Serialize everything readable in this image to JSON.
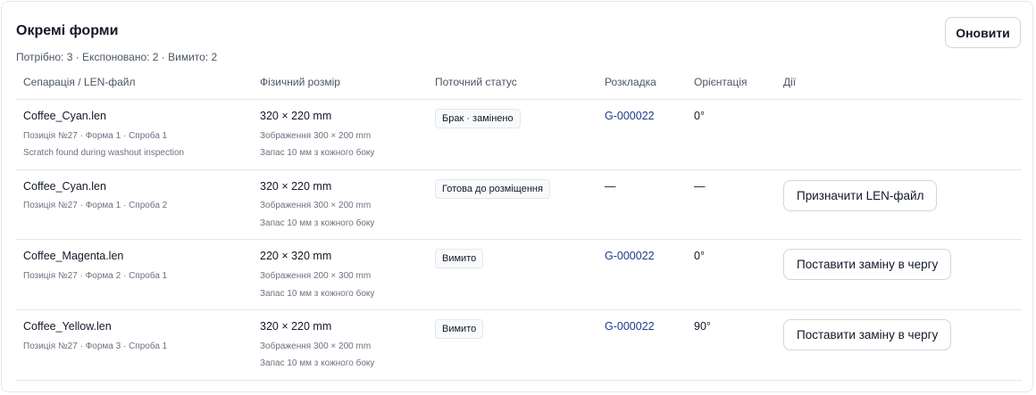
{
  "panel": {
    "title": "Окремі форми",
    "summary": "Потрібно: 3 · Експоновано: 2 · Вимито: 2",
    "refresh_label": "Оновити"
  },
  "table": {
    "headers": [
      "Сепарація / LEN-файл",
      "Фізичний розмір",
      "Поточний статус",
      "Розкладка",
      "Орієнтація",
      "Дії"
    ],
    "rows": [
      {
        "file": "Coffee_Cyan.len",
        "meta": "Позиція №27 · Форма 1 · Спроба 1",
        "note": "Scratch found during washout inspection",
        "size": "320 × 220 mm",
        "image_size": "Зображення 300 × 200 mm",
        "margin": "Запас 10 мм з кожного боку",
        "status": "Брак · замінено",
        "layout": "G-000022",
        "orientation": "0°",
        "action": ""
      },
      {
        "file": "Coffee_Cyan.len",
        "meta": "Позиція №27 · Форма 1 · Спроба 2",
        "note": "",
        "size": "320 × 220 mm",
        "image_size": "Зображення 300 × 200 mm",
        "margin": "Запас 10 мм з кожного боку",
        "status": "Готова до розміщення",
        "layout": "—",
        "orientation": "—",
        "action": "Призначити LEN-файл"
      },
      {
        "file": "Coffee_Magenta.len",
        "meta": "Позиція №27 · Форма 2 · Спроба 1",
        "note": "",
        "size": "220 × 320 mm",
        "image_size": "Зображення 200 × 300 mm",
        "margin": "Запас 10 мм з кожного боку",
        "status": "Вимито",
        "layout": "G-000022",
        "orientation": "0°",
        "action": "Поставити заміну в чергу"
      },
      {
        "file": "Coffee_Yellow.len",
        "meta": "Позиція №27 · Форма 3 · Спроба 1",
        "note": "",
        "size": "320 × 220 mm",
        "image_size": "Зображення 300 × 200 mm",
        "margin": "Запас 10 мм з кожного боку",
        "status": "Вимито",
        "layout": "G-000022",
        "orientation": "90°",
        "action": "Поставити заміну в чергу"
      }
    ]
  }
}
